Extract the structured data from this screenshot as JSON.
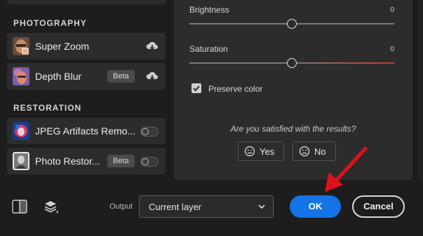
{
  "left_panel": {
    "sections": [
      {
        "heading": "PHOTOGRAPHY",
        "items": [
          {
            "label": "Super Zoom",
            "badge": "",
            "action_icon": "cloud-download-icon"
          },
          {
            "label": "Depth Blur",
            "badge": "Beta",
            "action_icon": "cloud-download-icon"
          }
        ]
      },
      {
        "heading": "RESTORATION",
        "items": [
          {
            "label": "JPEG Artifacts Remo...",
            "badge": "",
            "action_icon": "toggle-switch",
            "enabled": false
          },
          {
            "label": "Photo Restor...",
            "badge": "Beta",
            "action_icon": "toggle-switch",
            "enabled": false
          }
        ]
      }
    ]
  },
  "settings": {
    "brightness": {
      "label": "Brightness",
      "value": "0"
    },
    "saturation": {
      "label": "Saturation",
      "value": "0"
    },
    "preserve_color": {
      "label": "Preserve color",
      "checked": true
    },
    "feedback": {
      "question": "Are you satisfied with the results?",
      "yes_label": "Yes",
      "no_label": "No"
    }
  },
  "bottom_bar": {
    "compare_icon": "split-view-icon",
    "layers_icon": "layers-icon",
    "output_label": "Output",
    "output_value": "Current layer",
    "ok_label": "OK",
    "cancel_label": "Cancel"
  },
  "colors": {
    "accent": "#1473e6",
    "annotation": "#e0101a",
    "saturation_track": "#c0393b"
  }
}
